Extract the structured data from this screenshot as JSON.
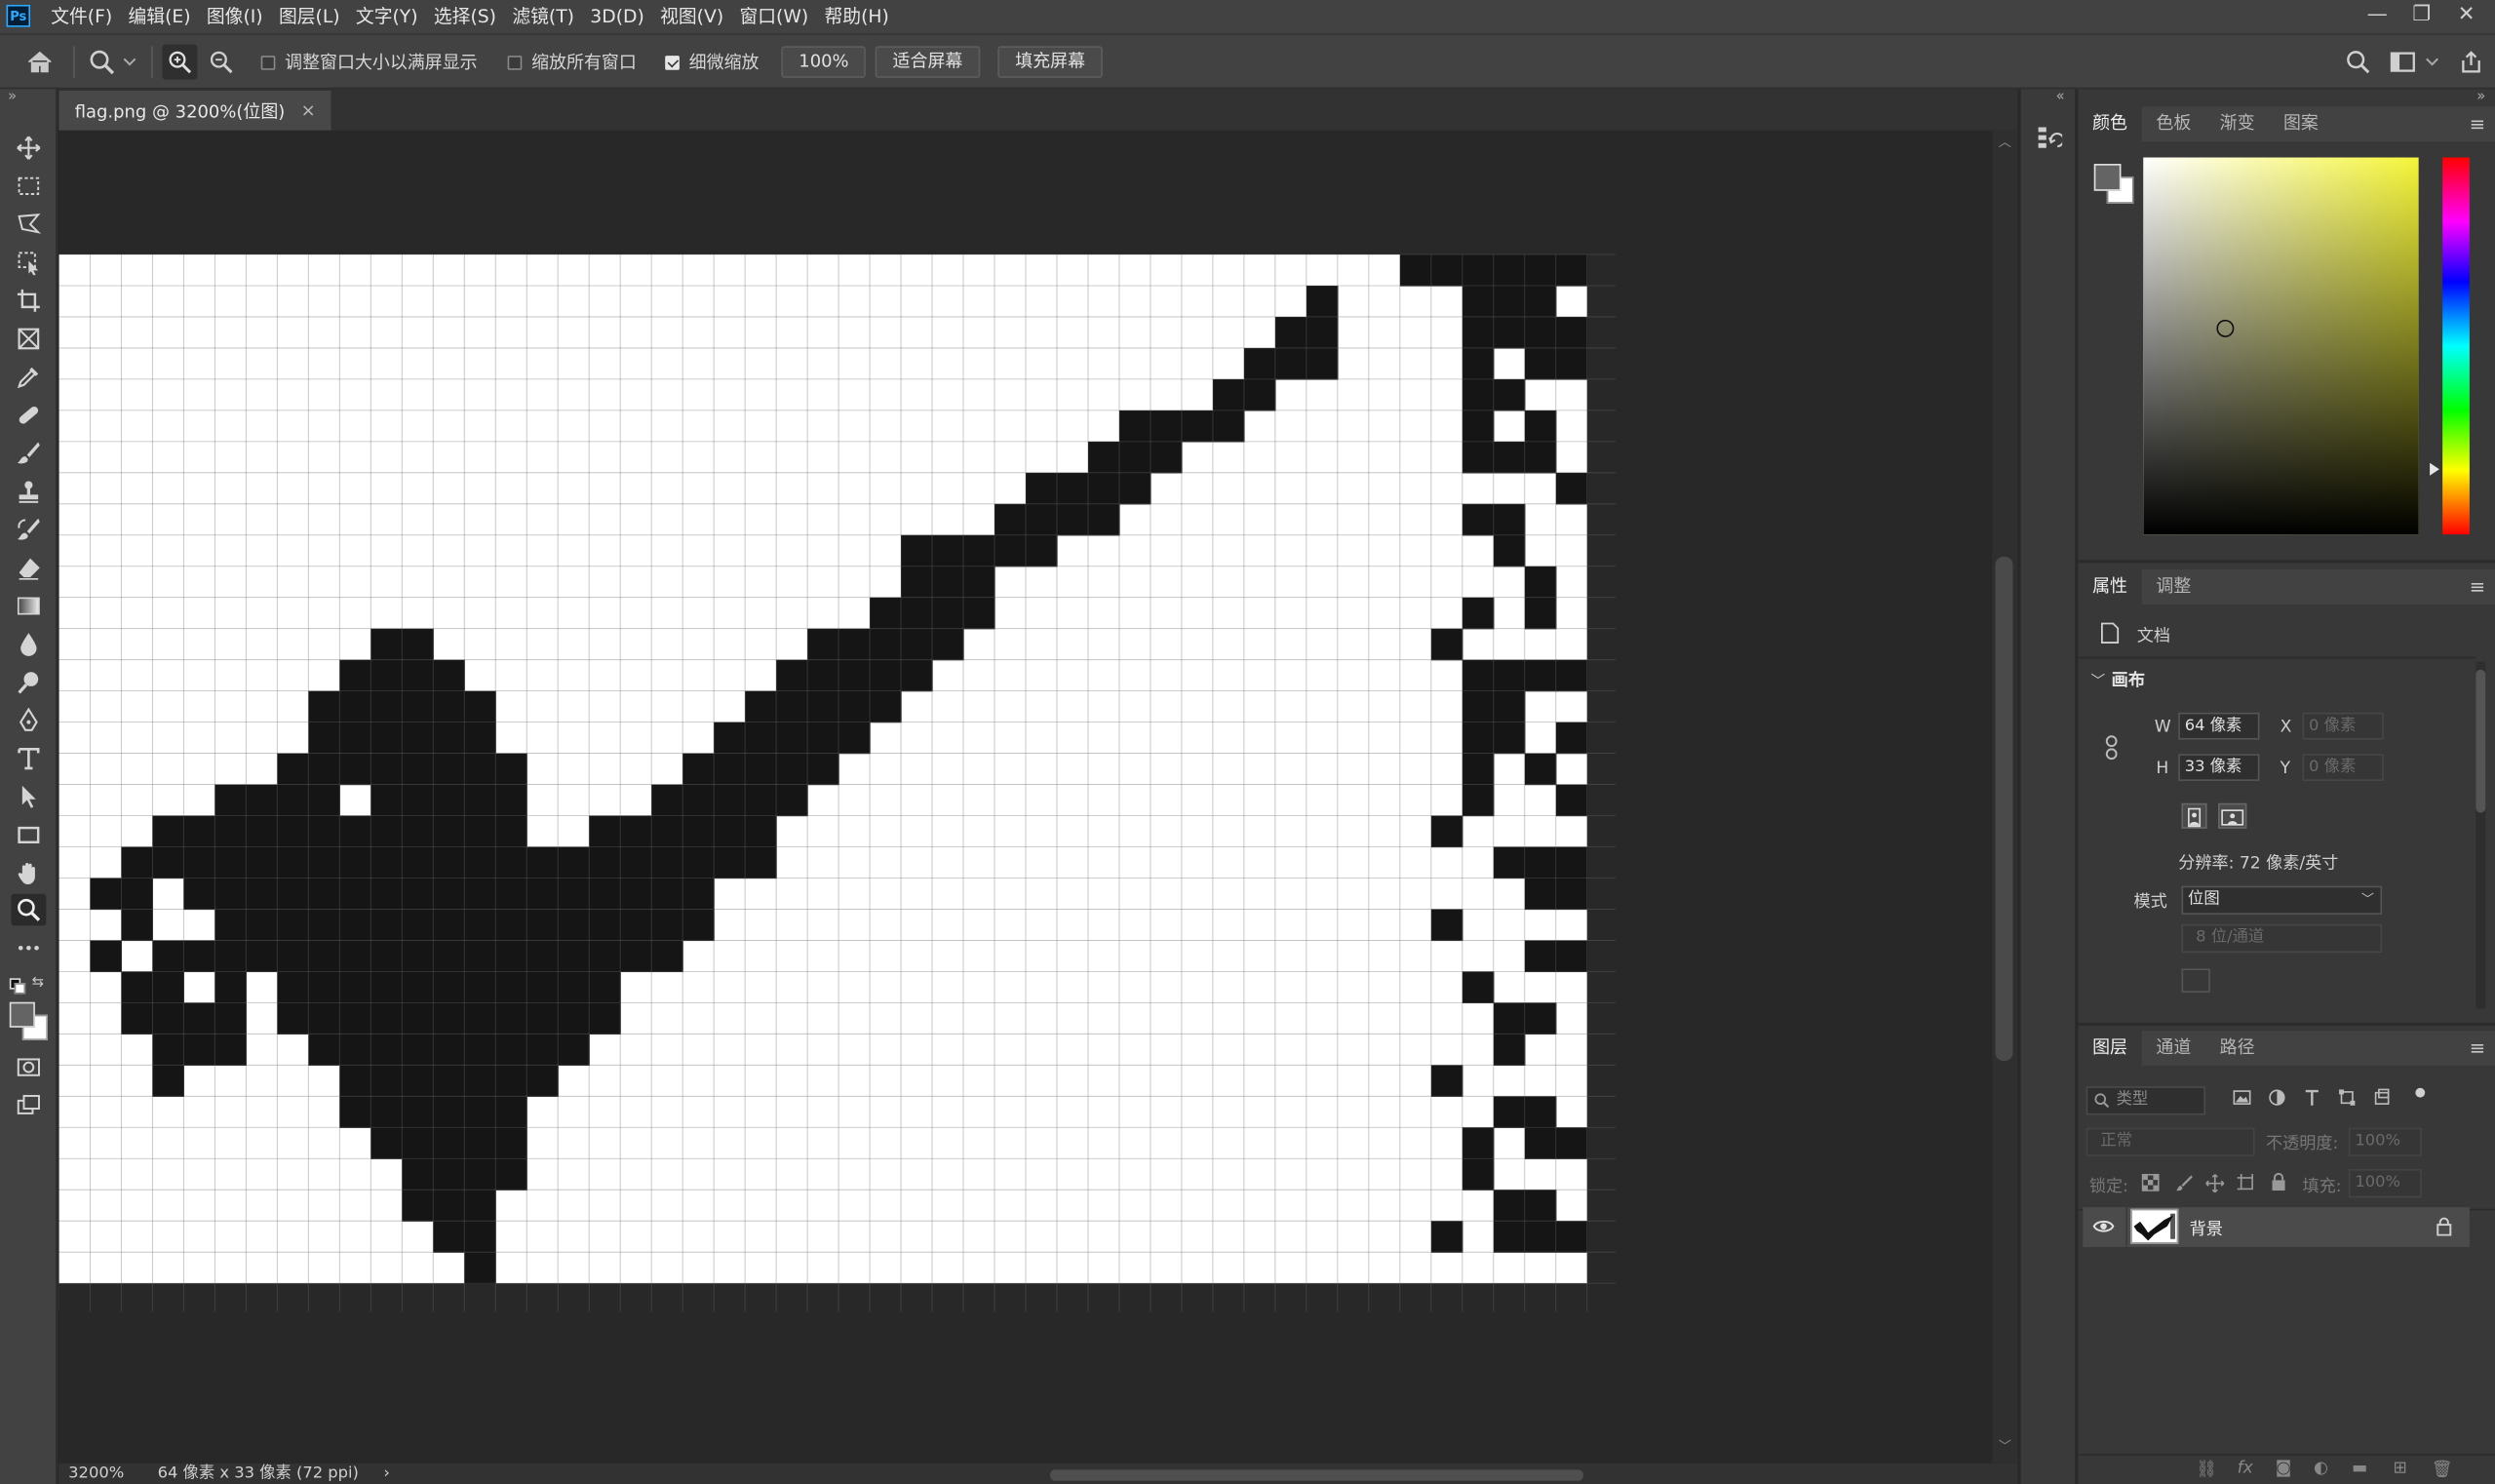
{
  "app": {
    "logo_text": "Ps",
    "menu": [
      "文件(F)",
      "编辑(E)",
      "图像(I)",
      "图层(L)",
      "文字(Y)",
      "选择(S)",
      "滤镜(T)",
      "3D(D)",
      "视图(V)",
      "窗口(W)",
      "帮助(H)"
    ],
    "window_controls": [
      "—",
      "❐",
      "✕"
    ]
  },
  "options_bar": {
    "resize_windows_label": "调整窗口大小以满屏显示",
    "resize_windows_checked": false,
    "zoom_all_label": "缩放所有窗口",
    "zoom_all_checked": false,
    "scrubby_zoom_label": "细微缩放",
    "scrubby_zoom_checked": true,
    "zoom_100_label": "100%",
    "fit_screen_label": "适合屏幕",
    "fill_screen_label": "填充屏幕"
  },
  "document": {
    "tab_title": "flag.png @ 3200%(位图)",
    "tab_close": "×",
    "zoom_status": "3200%",
    "size_status": "64 像素 x 33 像素 (72 ppi)",
    "status_arrow": "›",
    "visible_columns": 49,
    "visible_rows": 33,
    "pixel_rows": [
      "000000000000000000000000000000000000000000011111111",
      "000000000000000000000000000000000000000010000111011",
      "000000000000000000000000000000000000000110000111101",
      "000000000000000000000000000000000000001110000101100",
      "000000000000000000000000000000000000011000000110000",
      "000000000000000000000000000000000011110000000101011",
      "000000000000000000000000000000000111000000000111001",
      "000000000000000000000000000000011110000000000000100",
      "000000000000000000000000000000111100000000000110001",
      "000000000000000000000000000111110000000000000010000",
      "000000000000000000000000000111000000000000000001000",
      "000000000000000000000000001111000000000000000101011",
      "000000000011000000000000111110000000000000001000000",
      "000000000111100000000001111100000000000000000111100",
      "000000001111110000000011111000000000000000000110000",
      "000000001111110000000111110000000000000000000110100",
      "000000011111111000001111100000000000000000000101001",
      "000001111011111000011111000000000000000000000100101",
      "000111111111111001111110000000000000000000001000000",
      "001111111111111111111110000000000000000000000011100",
      "011011111111111111111000000000000000000000000001111",
      "001001111111111111111000000000000000000000001000000",
      "010111111111111111110000000000000000000000000001100",
      "001101011111111111000000000000000000000000000100000",
      "001111011111111111000000000000000000000000000011011",
      "000111001111111110000000000000000000000000000010001",
      "000100000111111100000000000000000000000000001000000",
      "000000000111111000000000000000000000000000000011000",
      "000000000011111000000000000000000000000000000101100",
      "000000000001111000000000000000000000000000000100001",
      "000000000001110000000000000000000000000000000011000",
      "000000000000110000000000000000000000000000001011100",
      "000000000000010000000000000000000000000000000000010"
    ]
  },
  "color_panel": {
    "tabs": [
      "颜色",
      "色板",
      "渐变",
      "图案"
    ],
    "active_tab": "颜色",
    "hue_color": "#f5f53a"
  },
  "properties_panel": {
    "tabs": [
      "属性",
      "调整"
    ],
    "active_tab": "属性",
    "doc_label": "文档",
    "canvas_section": "画布",
    "w_label": "W",
    "w_value": "64 像素",
    "h_label": "H",
    "h_value": "33 像素",
    "x_label": "X",
    "x_placeholder": "0 像素",
    "y_label": "Y",
    "y_placeholder": "0 像素",
    "resolution": "分辨率: 72 像素/英寸",
    "mode_label": "模式",
    "mode_value": "位图",
    "bit_depth": "8 位/通道"
  },
  "layers_panel": {
    "tabs": [
      "图层",
      "通道",
      "路径"
    ],
    "active_tab": "图层",
    "filter_placeholder": "类型",
    "blend_mode": "正常",
    "opacity_label": "不透明度:",
    "opacity_value": "100%",
    "lock_label": "锁定:",
    "fill_label": "填充:",
    "fill_value": "100%",
    "layers": [
      {
        "name": "背景",
        "visible": true,
        "locked": true
      }
    ]
  }
}
